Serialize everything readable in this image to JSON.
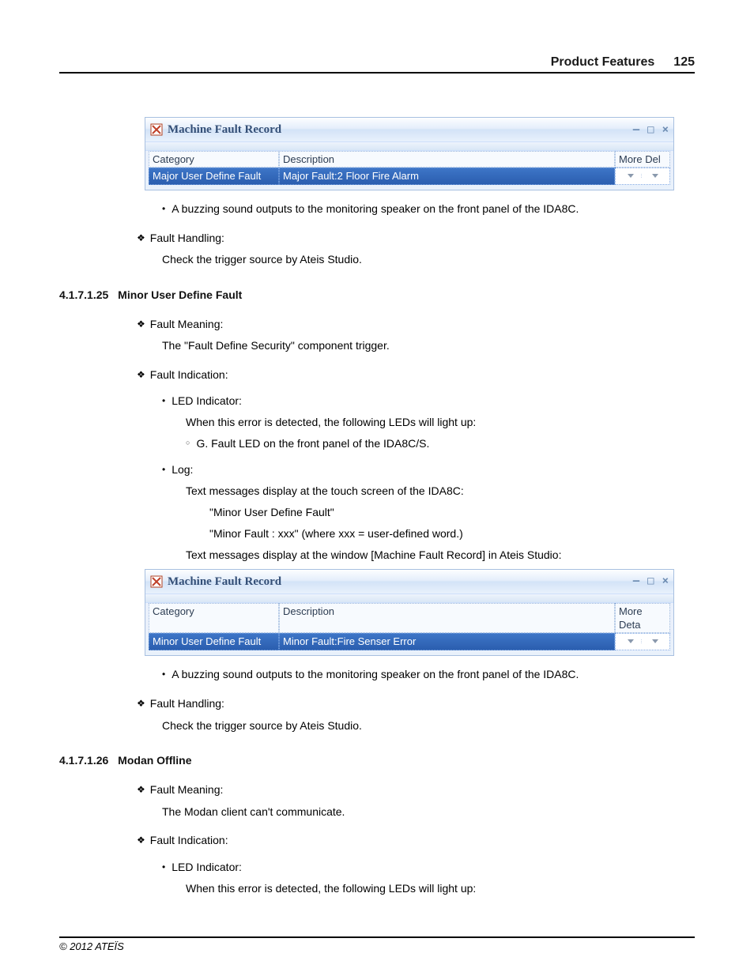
{
  "header": {
    "title": "Product Features",
    "page_number": "125"
  },
  "footer": {
    "copyright": "© 2012 ATEÏS"
  },
  "screenshots": {
    "s1": {
      "window_title": "Machine Fault Record",
      "columns": {
        "category": "Category",
        "description": "Description",
        "more": "More Del"
      },
      "row": {
        "category": "Major User Define Fault",
        "description": "Major Fault:2 Floor Fire Alarm"
      }
    },
    "s2": {
      "window_title": "Machine Fault Record",
      "columns": {
        "category": "Category",
        "description": "Description",
        "more": "More Deta"
      },
      "row": {
        "category": "Minor User Define Fault",
        "description": "Minor Fault:Fire Senser Error"
      }
    }
  },
  "body": {
    "buzz1": "A buzzing sound outputs to the monitoring speaker on the front panel of the IDA8C.",
    "fault_handling_label": "Fault Handling:",
    "check_trigger": "Check the trigger source by Ateis Studio.",
    "sec25": {
      "num": "4.1.7.1.25",
      "title": "Minor User Define Fault"
    },
    "fault_meaning_label": "Fault Meaning:",
    "fault_meaning_25": "The \"Fault Define Security\" component trigger.",
    "fault_indication_label": "Fault Indication:",
    "led_indicator_label": "LED Indicator:",
    "led_detected": "When this error is detected, the following LEDs will light up:",
    "led_item_25": "G. Fault LED on the front panel of the IDA8C/S.",
    "log_label": "Log:",
    "log_touch": "Text messages display at the touch screen of the IDA8C:",
    "log_msg_25a": "\"Minor User Define Fault\"",
    "log_msg_25b": "\"Minor Fault : xxx\" (where xxx = user-defined word.)",
    "log_window": "Text messages display at the window [Machine Fault Record] in Ateis Studio:",
    "buzz2": "A buzzing sound outputs to the monitoring speaker on the front panel of the IDA8C.",
    "sec26": {
      "num": "4.1.7.1.26",
      "title": "Modan Offline"
    },
    "fault_meaning_26": "The Modan client can't communicate."
  }
}
